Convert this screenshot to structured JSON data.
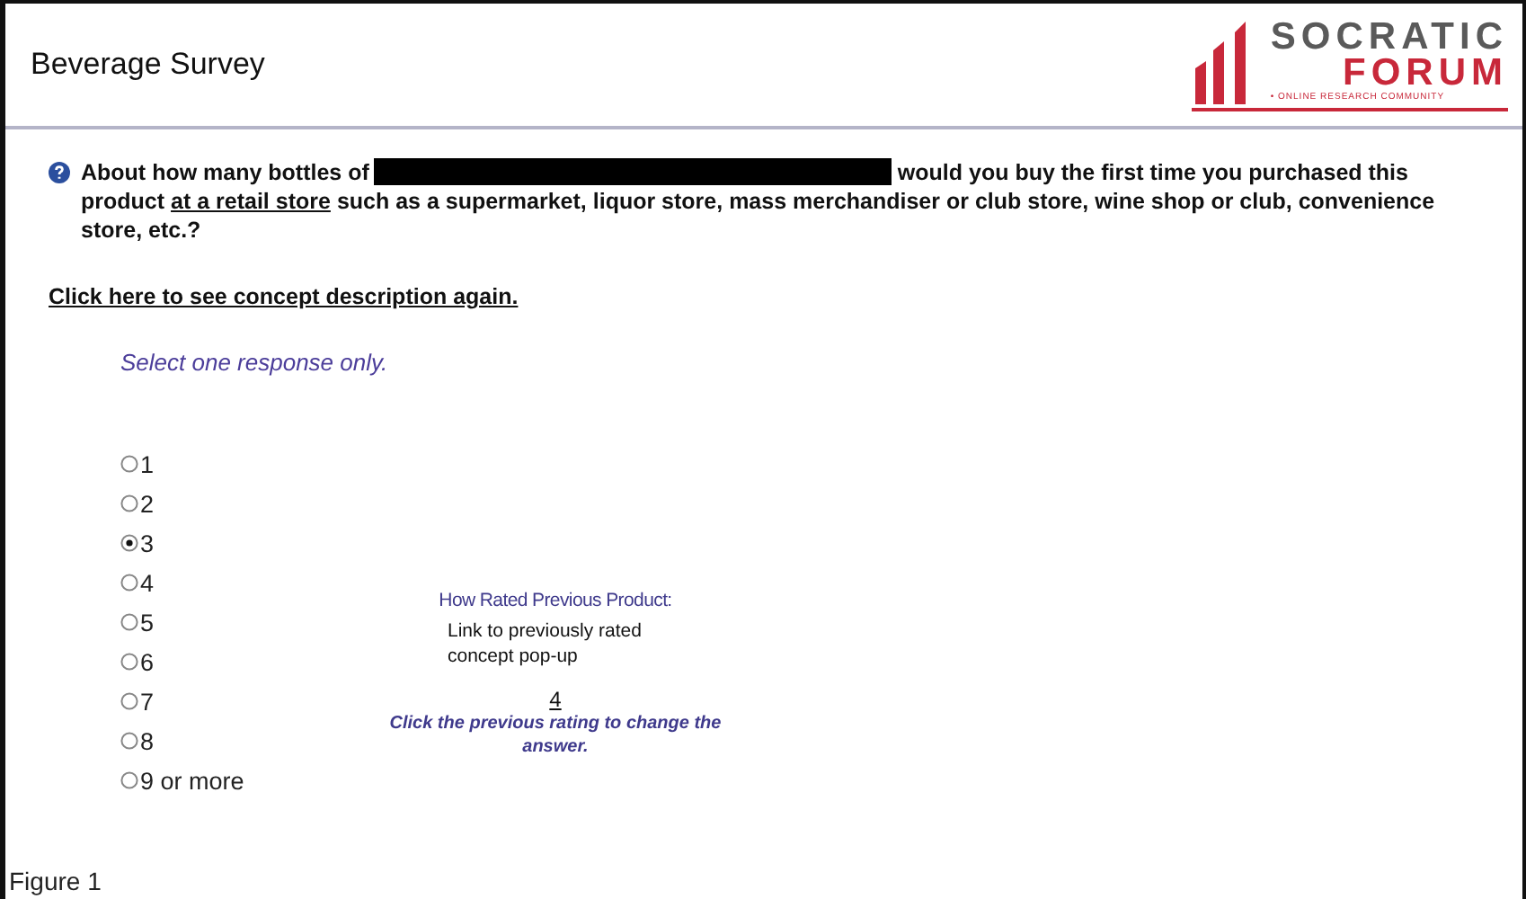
{
  "header": {
    "title": "Beverage Survey",
    "logo": {
      "name_top": "SOCRATIC",
      "name_bottom": "FORUM",
      "tagline": "• ONLINE RESEARCH COMMUNITY"
    }
  },
  "question": {
    "before": "About how many bottles of",
    "after": "would you buy the first time you purchased this product",
    "link": "at a retail store",
    "rest": "such as a supermarket, liquor store, mass merchandiser or club store, wine shop or club, convenience store, etc.?"
  },
  "concept_link": "Click here to see concept description again.",
  "instruction": "Select one response only.",
  "options": [
    {
      "label": "1",
      "selected": false
    },
    {
      "label": "2",
      "selected": false
    },
    {
      "label": "3",
      "selected": true
    },
    {
      "label": "4",
      "selected": false
    },
    {
      "label": "5",
      "selected": false
    },
    {
      "label": "6",
      "selected": false
    },
    {
      "label": "7",
      "selected": false
    },
    {
      "label": "8",
      "selected": false
    },
    {
      "label": "9 or more",
      "selected": false
    }
  ],
  "previous": {
    "heading": "How Rated Previous Product:",
    "note": "Link to previously rated concept pop-up",
    "rating": "4",
    "hint": "Click the previous rating to change the answer."
  },
  "caption": "Figure 1"
}
